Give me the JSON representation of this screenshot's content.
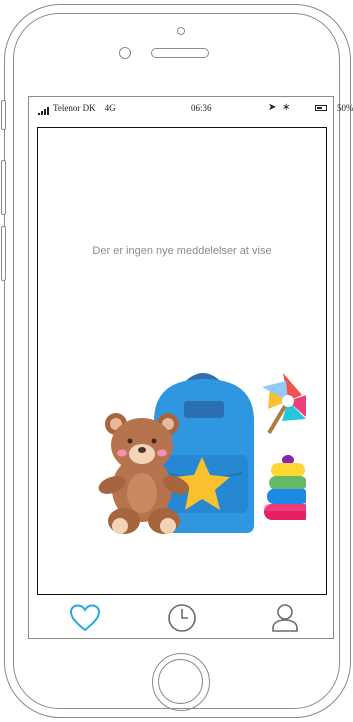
{
  "status_bar": {
    "carrier": "Telenor DK",
    "network": "4G",
    "time": "06:36",
    "battery_percent": "50%"
  },
  "main": {
    "empty_message": "Der er ingen nye meddelelser at vise",
    "illustration_icon": "toys-illustration"
  },
  "tabbar": {
    "tabs": [
      {
        "icon": "heart-icon",
        "active": true
      },
      {
        "icon": "clock-icon",
        "active": false
      },
      {
        "icon": "user-icon",
        "active": false
      }
    ]
  },
  "colors": {
    "accent": "#29a8e0",
    "inactive_icon": "#6b6b6b",
    "frame": "#8a8a8a"
  }
}
